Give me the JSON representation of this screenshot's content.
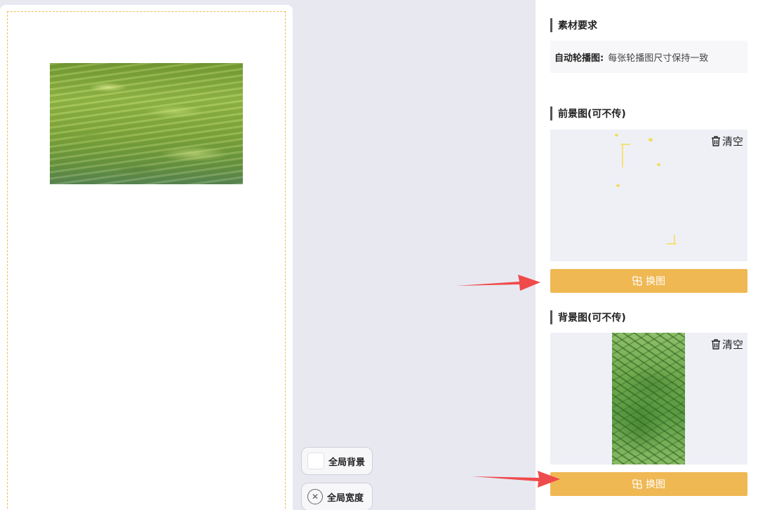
{
  "canvas": {
    "frame_color": "#f0bd52"
  },
  "tools": {
    "global_background_label": "全局背景",
    "global_width_label": "全局宽度"
  },
  "panel": {
    "requirements": {
      "title": "素材要求",
      "item_label": "自动轮播图:",
      "item_text": "每张轮播图尺寸保持一致"
    },
    "foreground": {
      "title": "前景图(可不传)",
      "clear_label": "清空",
      "swap_label": "换图"
    },
    "background": {
      "title": "背景图(可不传)",
      "clear_label": "清空",
      "swap_label": "换图"
    }
  },
  "colors": {
    "accent": "#efb853",
    "arrow": "#ef4b4b",
    "page_bg": "#e8e8f1"
  },
  "icons": [
    "trash-icon",
    "swap-image-icon",
    "close-circle-icon",
    "color-swatch"
  ]
}
